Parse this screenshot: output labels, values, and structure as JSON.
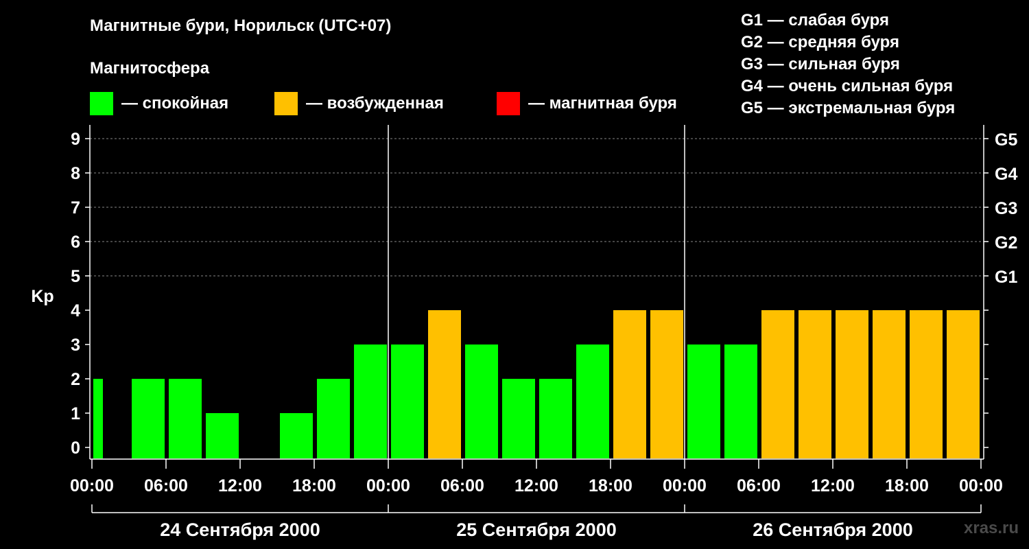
{
  "title": "Магнитные бури, Норильск (UTC+07)",
  "legend": {
    "heading": "Магнитосфера",
    "items": [
      {
        "label": "— спокойная",
        "color": "#00ff00"
      },
      {
        "label": "— возбужденная",
        "color": "#ffc000"
      },
      {
        "label": "— магнитная буря",
        "color": "#ff0000"
      }
    ]
  },
  "g_scale": [
    "G1 — слабая буря",
    "G2 — средняя буря",
    "G3 — сильная буря",
    "G4 — очень сильная буря",
    "G5 — экстремальная буря"
  ],
  "watermark": "xras.ru",
  "chart_data": {
    "type": "bar",
    "ylabel": "Kp",
    "ylim": [
      0,
      9
    ],
    "yticks": [
      0,
      1,
      2,
      3,
      4,
      5,
      6,
      7,
      8,
      9
    ],
    "right_axis": [
      {
        "value": 5,
        "label": "G1"
      },
      {
        "value": 6,
        "label": "G2"
      },
      {
        "value": 7,
        "label": "G3"
      },
      {
        "value": 8,
        "label": "G4"
      },
      {
        "value": 9,
        "label": "G5"
      }
    ],
    "x_tick_labels": [
      "00:00",
      "06:00",
      "12:00",
      "18:00",
      "00:00",
      "06:00",
      "12:00",
      "18:00",
      "00:00",
      "06:00",
      "12:00",
      "18:00",
      "00:00"
    ],
    "dates": [
      "24 Сентября 2000",
      "25 Сентября 2000",
      "26 Сентября 2000"
    ],
    "categories": [
      "24.09 00:00",
      "24.09 03:00",
      "24.09 06:00",
      "24.09 09:00",
      "24.09 12:00",
      "24.09 15:00",
      "24.09 18:00",
      "24.09 21:00",
      "25.09 00:00",
      "25.09 03:00",
      "25.09 06:00",
      "25.09 09:00",
      "25.09 12:00",
      "25.09 15:00",
      "25.09 18:00",
      "25.09 21:00",
      "26.09 00:00",
      "26.09 03:00",
      "26.09 06:00",
      "26.09 09:00",
      "26.09 12:00",
      "26.09 15:00",
      "26.09 18:00",
      "26.09 21:00"
    ],
    "values": [
      2,
      2,
      2,
      1,
      0,
      1,
      2,
      3,
      3,
      4,
      3,
      2,
      2,
      3,
      4,
      4,
      3,
      3,
      4,
      4,
      4,
      4,
      4,
      4
    ],
    "first_bar_partial": true,
    "colors": {
      "calm": "#00ff00",
      "disturbed": "#ffc000",
      "storm": "#ff0000"
    },
    "grid": "dashed at Kp 5–9"
  }
}
